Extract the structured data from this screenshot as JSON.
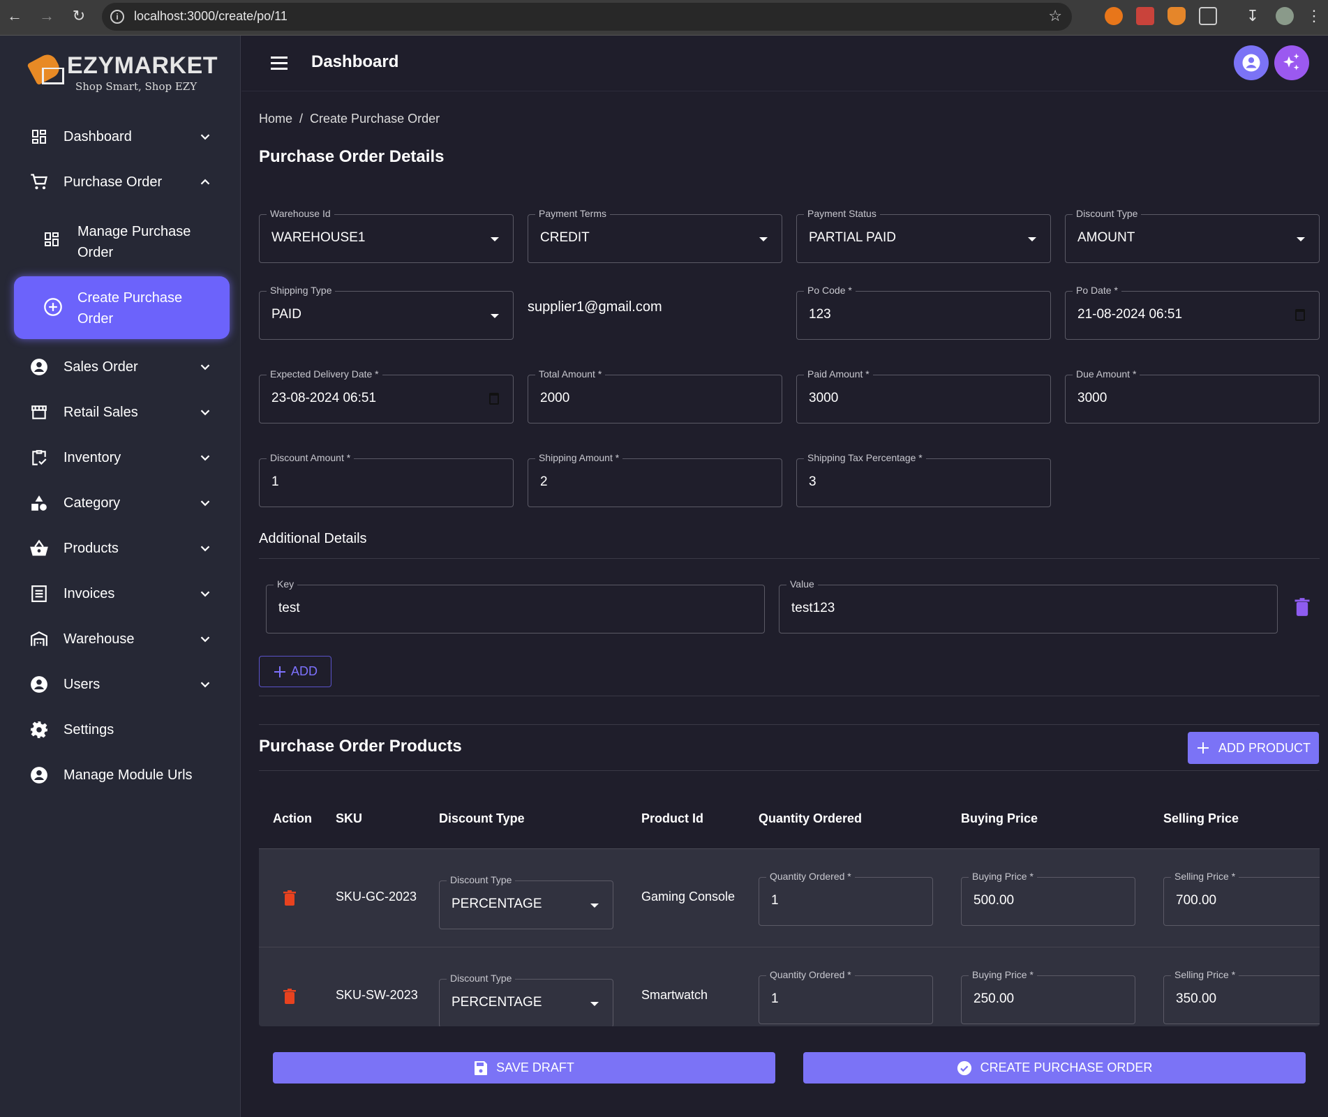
{
  "browser": {
    "url": "localhost:3000/create/po/11"
  },
  "brand": {
    "name": "EZYMARKET",
    "slogan": "Shop Smart, Shop EZY"
  },
  "sidebar": {
    "items": [
      {
        "label": "Dashboard",
        "icon": "dashboard-icon",
        "expanded": false
      },
      {
        "label": "Purchase Order",
        "icon": "cart-icon",
        "expanded": true
      },
      {
        "label": "Sales Order",
        "icon": "account-circle-icon",
        "expanded": false
      },
      {
        "label": "Retail Sales",
        "icon": "storefront-icon",
        "expanded": false
      },
      {
        "label": "Inventory",
        "icon": "clipboard-check-icon",
        "expanded": false
      },
      {
        "label": "Category",
        "icon": "shapes-icon",
        "expanded": false
      },
      {
        "label": "Products",
        "icon": "basket-icon",
        "expanded": false
      },
      {
        "label": "Invoices",
        "icon": "receipt-icon",
        "expanded": false
      },
      {
        "label": "Warehouse",
        "icon": "warehouse-icon",
        "expanded": false
      },
      {
        "label": "Users",
        "icon": "account-circle-icon",
        "expanded": false
      },
      {
        "label": "Settings",
        "icon": "gear-icon"
      },
      {
        "label": "Manage Module Urls",
        "icon": "account-circle-icon"
      }
    ],
    "sub_items": [
      {
        "label": "Manage Purchase Order",
        "icon": "dashboard-icon",
        "active": false
      },
      {
        "label": "Create Purchase Order",
        "icon": "add-circle-icon",
        "active": true
      }
    ]
  },
  "topbar": {
    "title": "Dashboard"
  },
  "breadcrumb": {
    "home": "Home",
    "separator": "/",
    "current": "Create Purchase Order"
  },
  "details": {
    "title": "Purchase Order Details",
    "warehouse_id": {
      "label": "Warehouse Id",
      "value": "WAREHOUSE1"
    },
    "payment_terms": {
      "label": "Payment Terms",
      "value": "CREDIT"
    },
    "payment_status": {
      "label": "Payment Status",
      "value": "PARTIAL PAID"
    },
    "discount_type": {
      "label": "Discount Type",
      "value": "AMOUNT"
    },
    "shipping_type": {
      "label": "Shipping Type",
      "value": "PAID"
    },
    "supplier_email": "supplier1@gmail.com",
    "po_code": {
      "label": "Po Code *",
      "value": "123"
    },
    "po_date": {
      "label": "Po Date *",
      "value": "21-08-2024 06:51"
    },
    "expected_delivery_date": {
      "label": "Expected Delivery Date *",
      "value": "23-08-2024 06:51"
    },
    "total_amount": {
      "label": "Total Amount *",
      "value": "2000"
    },
    "paid_amount": {
      "label": "Paid Amount *",
      "value": "3000"
    },
    "due_amount": {
      "label": "Due Amount *",
      "value": "3000"
    },
    "discount_amount": {
      "label": "Discount Amount *",
      "value": "1"
    },
    "shipping_amount": {
      "label": "Shipping Amount *",
      "value": "2"
    },
    "shipping_tax_percentage": {
      "label": "Shipping Tax Percentage *",
      "value": "3"
    }
  },
  "additional": {
    "title": "Additional Details",
    "key_label": "Key",
    "key_value": "test",
    "value_label": "Value",
    "value_value": "test123",
    "add_label": "ADD"
  },
  "products": {
    "title": "Purchase Order Products",
    "add_label": "ADD PRODUCT",
    "columns": [
      "Action",
      "SKU",
      "Discount Type",
      "Product Id",
      "Quantity Ordered",
      "Buying Price",
      "Selling Price"
    ],
    "field_labels": {
      "discount_type": "Discount Type",
      "quantity": "Quantity Ordered *",
      "buying": "Buying Price *",
      "selling": "Selling Price *"
    },
    "rows": [
      {
        "sku": "SKU-GC-2023",
        "discount_type": "PERCENTAGE",
        "product_id": "Gaming Console",
        "quantity": "1",
        "buying_price": "500.00",
        "selling_price": "700.00"
      },
      {
        "sku": "SKU-SW-2023",
        "discount_type": "PERCENTAGE",
        "product_id": "Smartwatch",
        "quantity": "1",
        "buying_price": "250.00",
        "selling_price": "350.00"
      }
    ]
  },
  "actions": {
    "save_draft": "SAVE DRAFT",
    "create_po": "CREATE PURCHASE ORDER"
  },
  "colors": {
    "accent": "#7b73f6",
    "active_nav": "#6c63fb",
    "delete_red": "#e8421f",
    "delete_purple": "#8e5cf0",
    "sparkle": "#9b59f0"
  }
}
